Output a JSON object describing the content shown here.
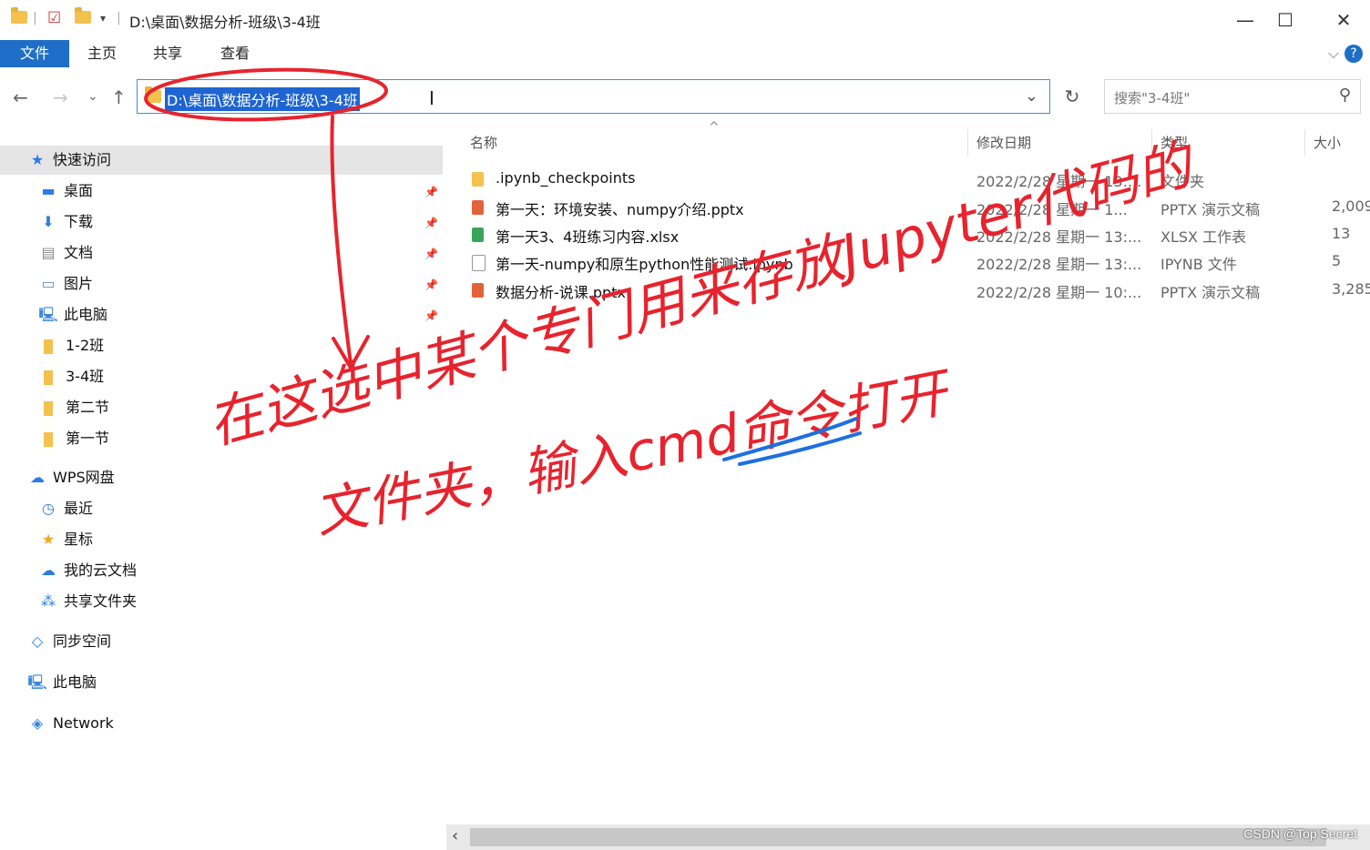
{
  "window": {
    "title": "D:\\桌面\\数据分析-班级\\3-4班",
    "minimize": "—",
    "maximize": "☐",
    "close": "✕"
  },
  "ribbon": {
    "tabs": [
      "文件",
      "主页",
      "共享",
      "查看"
    ],
    "help": "?"
  },
  "nav": {
    "address": "D:\\桌面\\数据分析-班级\\3-4班",
    "search_placeholder": "搜索\"3-4班\""
  },
  "sidebar": {
    "quick_access": "快速访问",
    "pinned": [
      "桌面",
      "下载",
      "文档",
      "图片",
      "此电脑"
    ],
    "folders": [
      "1-2班",
      "3-4班",
      "第二节",
      "第一节"
    ],
    "wps": "WPS网盘",
    "wps_items": [
      "最近",
      "星标",
      "我的云文档",
      "共享文件夹"
    ],
    "sync": "同步空间",
    "this_pc": "此电脑",
    "network": "Network"
  },
  "columns": {
    "name": "名称",
    "date": "修改日期",
    "type": "类型",
    "size": "大小"
  },
  "files": [
    {
      "name": ".ipynb_checkpoints",
      "date": "2022/2/28 星期一 13:...",
      "type": "文件夹",
      "size": "",
      "kind": "folder"
    },
    {
      "name": "第一天：环境安装、numpy介绍.pptx",
      "date": "2022/2/28 星期一 1...",
      "type": "PPTX 演示文稿",
      "size": "2,009",
      "kind": "pptx"
    },
    {
      "name": "第一天3、4班练习内容.xlsx",
      "date": "2022/2/28 星期一 13:...",
      "type": "XLSX 工作表",
      "size": "13",
      "kind": "xlsx"
    },
    {
      "name": "第一天-numpy和原生python性能测试.ipynb",
      "date": "2022/2/28 星期一 13:...",
      "type": "IPYNB 文件",
      "size": "5",
      "kind": "ipynb"
    },
    {
      "name": "数据分析-说课.pptx",
      "date": "2022/2/28 星期一 10:...",
      "type": "PPTX 演示文稿",
      "size": "3,285",
      "kind": "pptx"
    }
  ],
  "annotation": {
    "line1": "在这选中某个专门用来存放Jupyter代码的",
    "line2": "文件夹，输入cmd命令打开",
    "color": "#e8232d",
    "underline_color": "#1e6fe0"
  },
  "watermark": "CSDN @Top Secret"
}
